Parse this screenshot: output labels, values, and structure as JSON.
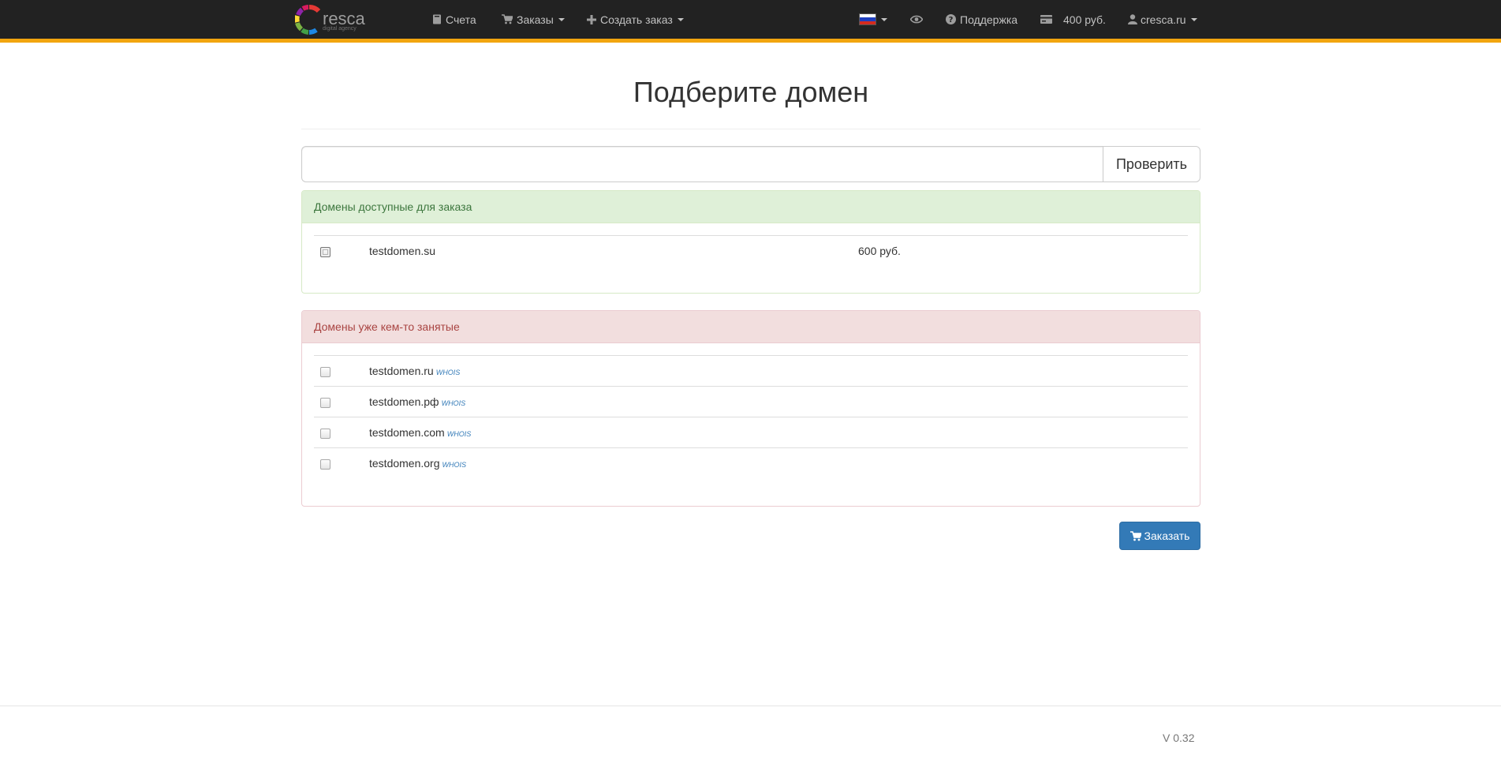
{
  "navbar": {
    "brand_word": "resca",
    "brand_tagline": "digital agency",
    "items": [
      {
        "label": "Счета",
        "icon": "book-icon",
        "dropdown": false
      },
      {
        "label": "Заказы",
        "icon": "cart-icon",
        "dropdown": true
      },
      {
        "label": "Создать заказ",
        "icon": "plus-icon",
        "dropdown": true
      }
    ],
    "language": {
      "icon": "russian-flag-icon"
    },
    "preview": {
      "icon": "eye-icon"
    },
    "support_label": "Поддержка",
    "balance_label": "400 руб.",
    "account_label": "cresca.ru",
    "accent_color": "#f2a50f"
  },
  "page": {
    "title": "Подберите домен",
    "search": {
      "value": "",
      "button_label": "Проверить"
    }
  },
  "available": {
    "heading": "Домены доступные для заказа",
    "rows": [
      {
        "domain": "testdomen.su",
        "price": "600 руб."
      }
    ]
  },
  "taken": {
    "heading": "Домены уже кем-то занятые",
    "whois_label": "WHOIS",
    "rows": [
      {
        "domain": "testdomen.ru"
      },
      {
        "domain": "testdomen.рф"
      },
      {
        "domain": "testdomen.com"
      },
      {
        "domain": "testdomen.org"
      }
    ]
  },
  "order_button_label": "Заказать",
  "footer": {
    "version": "V 0.32"
  }
}
